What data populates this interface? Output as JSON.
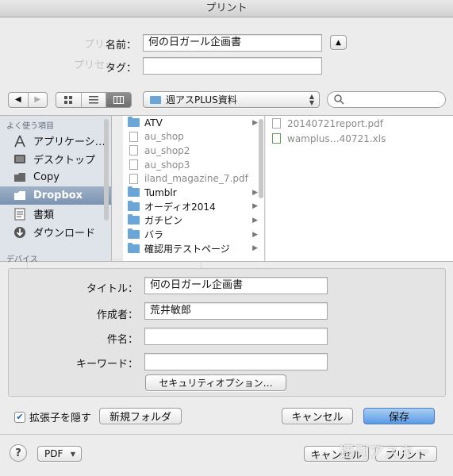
{
  "window": {
    "title": "プリント"
  },
  "save_panel": {
    "name_label": "名前：",
    "name_value": "何の日ガール企画書",
    "tag_label": "タグ：",
    "tag_value": "",
    "location": "週アスPLUS資料",
    "search_placeholder": ""
  },
  "sidebar": {
    "header": "よく使う項目",
    "items": [
      {
        "label": "アプリケーシ…",
        "icon": "applications-icon",
        "selected": false
      },
      {
        "label": "デスクトップ",
        "icon": "desktop-icon",
        "selected": false
      },
      {
        "label": "Copy",
        "icon": "folder-icon",
        "selected": false
      },
      {
        "label": "Dropbox",
        "icon": "folder-icon",
        "selected": true
      },
      {
        "label": "書類",
        "icon": "documents-icon",
        "selected": false
      },
      {
        "label": "ダウンロード",
        "icon": "downloads-icon",
        "selected": false
      }
    ],
    "devices_header": "デバイス"
  },
  "browser": {
    "column1": [
      {
        "name": "ATV",
        "kind": "folder",
        "dim": false,
        "arrow": true
      },
      {
        "name": "au_shop",
        "kind": "file",
        "dim": true,
        "arrow": false
      },
      {
        "name": "au_shop2",
        "kind": "file",
        "dim": true,
        "arrow": false
      },
      {
        "name": "au_shop3",
        "kind": "file",
        "dim": true,
        "arrow": false
      },
      {
        "name": "iland_magazine_7.pdf",
        "kind": "file",
        "dim": true,
        "arrow": false
      },
      {
        "name": "Tumblr",
        "kind": "folder",
        "dim": false,
        "arrow": true
      },
      {
        "name": "オーディオ2014",
        "kind": "folder",
        "dim": false,
        "arrow": true
      },
      {
        "name": "ガチピン",
        "kind": "folder",
        "dim": false,
        "arrow": true
      },
      {
        "name": "バラ",
        "kind": "folder",
        "dim": false,
        "arrow": true
      },
      {
        "name": "確認用テストページ",
        "kind": "folder",
        "dim": false,
        "arrow": true
      }
    ],
    "column2": [
      {
        "name": "20140721report.pdf",
        "kind": "file",
        "dim": true
      },
      {
        "name": "wamplus…40721.xls",
        "kind": "file",
        "dim": true
      }
    ]
  },
  "pdf_options": {
    "title_label": "タイトル：",
    "title_value": "何の日ガール企画書",
    "author_label": "作成者：",
    "author_value": "荒井敏郎",
    "subject_label": "件名：",
    "subject_value": "",
    "keywords_label": "キーワード：",
    "keywords_value": "",
    "security_button": "セキュリティオプション…"
  },
  "footer": {
    "hide_extension_label": "拡張子を隠す",
    "hide_extension_checked": true,
    "new_folder_label": "新規フォルダ",
    "cancel_label": "キャンセル",
    "save_label": "保存"
  },
  "print_dialog": {
    "help_label": "?",
    "pdf_label": "PDF",
    "cancel_label": "キャンセル",
    "print_label": "プリント"
  },
  "watermark": {
    "text": "週刊アスキー"
  },
  "colors": {
    "accent": "#5a9be6",
    "sidebar_selected": "#7b93b1",
    "folder": "#6aa6d8"
  }
}
